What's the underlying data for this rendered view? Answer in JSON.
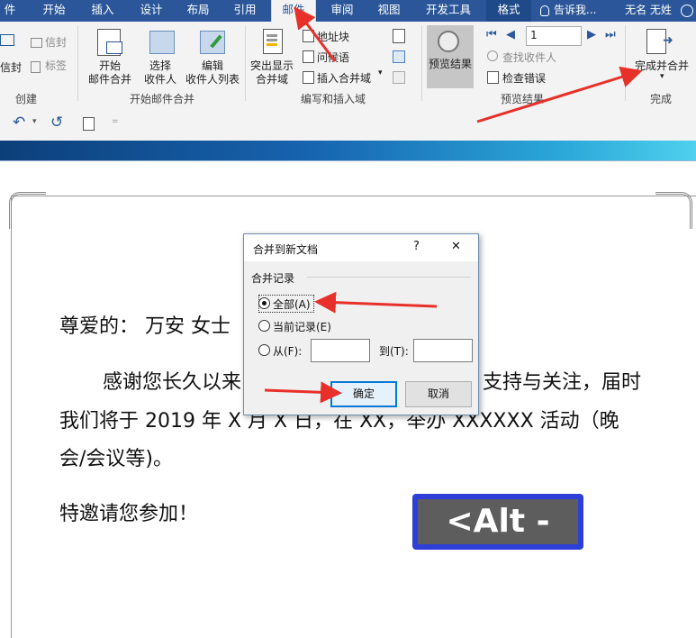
{
  "tabs": [
    "件",
    "开始",
    "插入",
    "设计",
    "布局",
    "引用",
    "邮件",
    "审阅",
    "视图",
    "开发工具",
    "格式"
  ],
  "active_tab": "邮件",
  "tell_me": "告诉我...",
  "user_name": "无名 无姓",
  "ribbon": {
    "create_group": {
      "items": [
        "信封",
        "信封",
        "标签"
      ],
      "label": "创建"
    },
    "start_merge": {
      "buttons": [
        "开始\n邮件合并",
        "选择\n收件人",
        "编辑\n收件人列表"
      ],
      "label": "开始邮件合并"
    },
    "write_insert": {
      "highlight_button": "突出显示\n合并域",
      "address_block": "地址块",
      "greeting_line": "问候语",
      "insert_merge_field": "插入合并域",
      "label": "编写和插入域"
    },
    "preview": {
      "preview_button": "预览结果",
      "record_value": "1",
      "find_recipient": "查找收件人",
      "check_errors": "检查错误",
      "label": "预览结果"
    },
    "finish": {
      "button": "完成并合并",
      "label": "完成"
    }
  },
  "document": {
    "salutation": "尊爱的：   万安  女士",
    "para1_line1": "感谢您长久以来",
    "para1_line1_end": "支持与关注，届时",
    "para1_line2": "我们将于 2019 年 X 月 X 日，在 XX，举办 XXXXXX 活动（晚",
    "para1_line3": "会/会议等)。",
    "invite": "特邀请您参加！"
  },
  "dialog": {
    "title": "合并到新文档",
    "help": "?",
    "close": "✕",
    "section_label": "合并记录",
    "option_all": "全部(A)",
    "option_current": "当前记录(E)",
    "option_from": "从(F):",
    "option_to": "到(T):",
    "from_value": "",
    "to_value": "",
    "ok": "确定",
    "cancel": "取消"
  },
  "hotkey_badge": "<Alt - q>",
  "colors": {
    "ribbon_blue": "#2b579a",
    "arrow_red": "#e8302a",
    "badge_border": "#2e3fd8",
    "badge_fill": "#5d5d5d"
  }
}
